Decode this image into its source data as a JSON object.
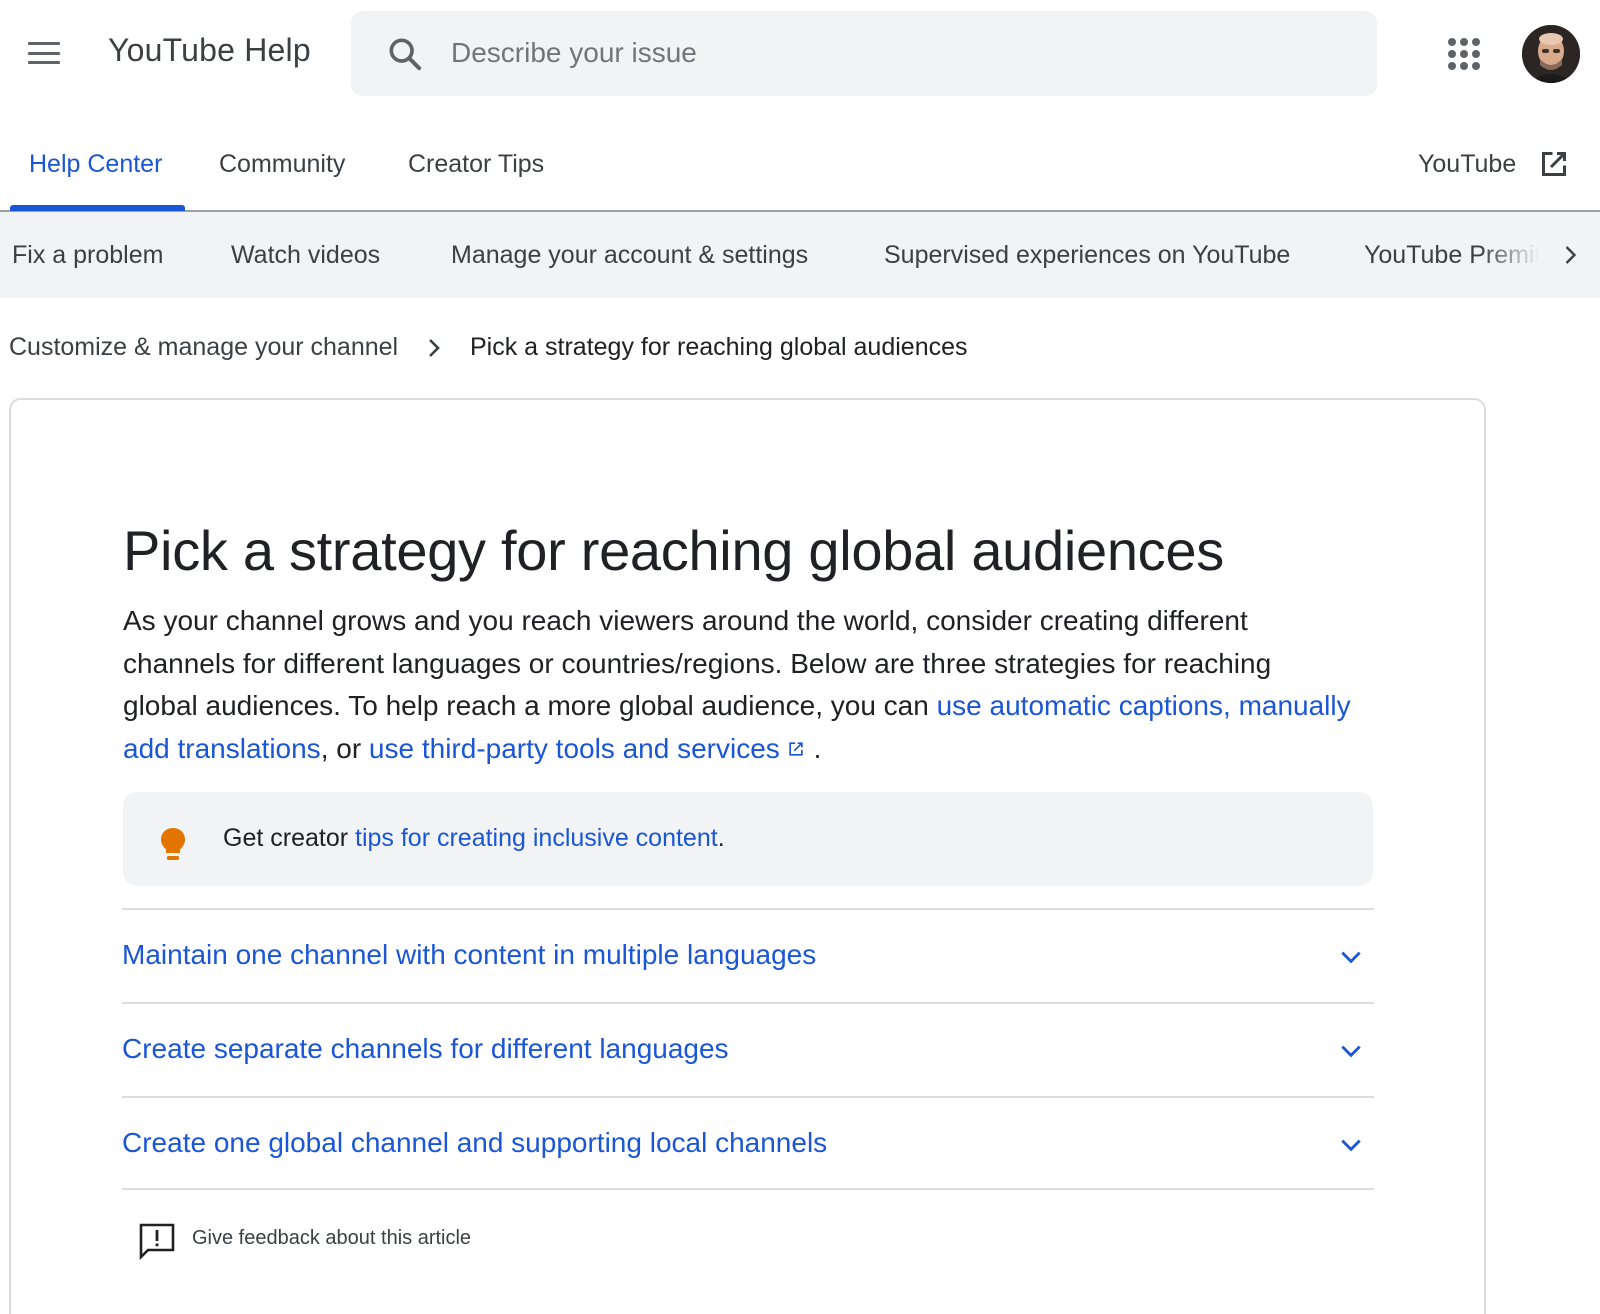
{
  "header": {
    "brand": "YouTube Help",
    "search_placeholder": "Describe your issue"
  },
  "tabs": {
    "items": [
      {
        "label": "Help Center",
        "active": true
      },
      {
        "label": "Community",
        "active": false
      },
      {
        "label": "Creator Tips",
        "active": false
      }
    ],
    "external_link_label": "YouTube"
  },
  "categories": [
    "Fix a problem",
    "Watch videos",
    "Manage your account & settings",
    "Supervised experiences on YouTube",
    "YouTube Premium"
  ],
  "breadcrumb": {
    "parent": "Customize & manage your channel",
    "current": "Pick a strategy for reaching global audiences"
  },
  "article": {
    "title": "Pick a strategy for reaching global audiences",
    "intro_text": "As your channel grows and you reach viewers around the world, consider creating different channels for different languages or countries/regions. Below are three strategies for reaching global audiences. To help reach a more global audience, you can ",
    "link_captions": "use automatic captions,",
    "link_translations": "manually add translations",
    "intro_or": ", or ",
    "link_third_party": "use third-party tools and services",
    "intro_end": ".",
    "tip_prefix": "Get creator ",
    "tip_link": "tips for creating inclusive content",
    "tip_suffix": ".",
    "accordion": [
      "Maintain one channel with content in multiple languages",
      "Create separate channels for different languages",
      "Create one global channel and supporting local channels"
    ],
    "feedback_label": "Give feedback about this article"
  },
  "colors": {
    "accent": "#1a56d6",
    "tip_bulb": "#e37400",
    "surface": "#f1f3f4"
  },
  "icons": {
    "menu": "menu-icon",
    "search": "search-icon",
    "apps": "apps-grid-icon",
    "external": "open-in-new-icon",
    "chevron": "chevron-right-icon",
    "bulb": "lightbulb-icon",
    "expand": "chevron-down-icon",
    "feedback": "feedback-icon"
  }
}
